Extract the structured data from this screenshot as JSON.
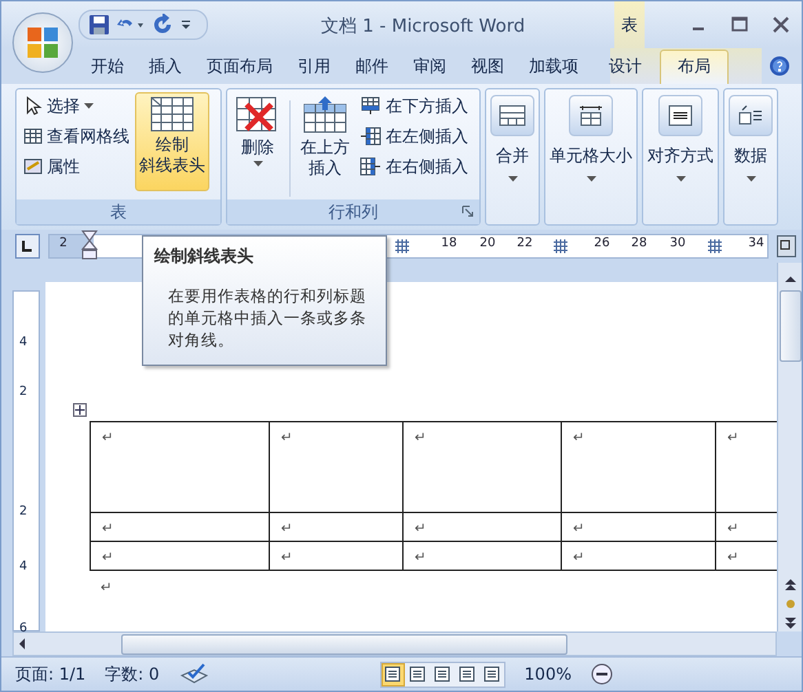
{
  "title_bar": {
    "title": "文档 1 - Microsoft Word",
    "context_label": "表"
  },
  "tabs": [
    {
      "label": "开始",
      "selected": false,
      "kind": "main"
    },
    {
      "label": "插入",
      "selected": false,
      "kind": "main"
    },
    {
      "label": "页面布局",
      "selected": false,
      "kind": "main"
    },
    {
      "label": "引用",
      "selected": false,
      "kind": "main"
    },
    {
      "label": "邮件",
      "selected": false,
      "kind": "main"
    },
    {
      "label": "审阅",
      "selected": false,
      "kind": "main"
    },
    {
      "label": "视图",
      "selected": false,
      "kind": "main"
    },
    {
      "label": "加载项",
      "selected": false,
      "kind": "main"
    },
    {
      "label": "设计",
      "selected": false,
      "kind": "context"
    },
    {
      "label": "布局",
      "selected": true,
      "kind": "context"
    }
  ],
  "ribbon": {
    "groups": [
      {
        "kind": "table",
        "label": "表",
        "small_items": [
          {
            "label": "选择",
            "dropdown": true
          },
          {
            "label": "查看网格线",
            "dropdown": false
          },
          {
            "label": "属性",
            "dropdown": false
          }
        ],
        "big_button": {
          "lines": [
            "绘制",
            "斜线表头"
          ],
          "highlighted": true
        }
      },
      {
        "kind": "rows_columns",
        "label": "行和列",
        "delete_button": {
          "label": "删除"
        },
        "insert_button": {
          "lines": [
            "在上方",
            "插入"
          ]
        },
        "small_items": [
          {
            "label": "在下方插入"
          },
          {
            "label": "在左侧插入"
          },
          {
            "label": "在右侧插入"
          }
        ]
      },
      {
        "kind": "menu",
        "button": "合并"
      },
      {
        "kind": "menu",
        "button": "单元格大小"
      },
      {
        "kind": "menu",
        "button": "对齐方式"
      },
      {
        "kind": "menu",
        "button": "数据"
      }
    ]
  },
  "ruler": {
    "numbers": [
      "2",
      "18",
      "20",
      "22",
      "26",
      "28",
      "30",
      "34"
    ]
  },
  "vertical_ruler": {
    "numbers": [
      "4",
      "2",
      "2",
      "4",
      "6"
    ]
  },
  "tooltip": {
    "title": "绘制斜线表头",
    "body": "在要用作表格的行和列标题的单元格中插入一条或多条对角线。"
  },
  "table": {
    "rows": [
      {
        "cells": [
          "↵",
          "↵",
          "↵",
          "↵",
          "↵"
        ]
      },
      {
        "cells": [
          "↵",
          "↵",
          "↵",
          "↵",
          "↵"
        ]
      },
      {
        "cells": [
          "↵",
          "↵",
          "↵",
          "↵",
          "↵"
        ]
      }
    ]
  },
  "after_table": "↵",
  "status_bar": {
    "page": "页面: 1/1",
    "words": "字数: 0",
    "views": [
      {
        "selected": true
      },
      {
        "selected": false
      },
      {
        "selected": false
      },
      {
        "selected": false
      },
      {
        "selected": false
      }
    ],
    "zoom": "100%"
  }
}
